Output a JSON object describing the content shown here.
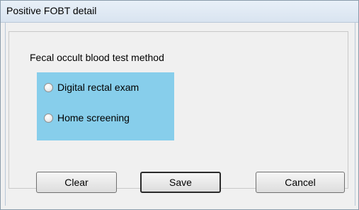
{
  "window": {
    "title": "Positive FOBT detail"
  },
  "group": {
    "label": "Fecal occult blood test method"
  },
  "radios": [
    {
      "label": "Digital rectal exam",
      "selected": false
    },
    {
      "label": "Home screening",
      "selected": false
    }
  ],
  "buttons": {
    "clear": "Clear",
    "save": "Save",
    "cancel": "Cancel"
  },
  "colors": {
    "panel": "#87ceeb",
    "window": "#f0f0f0"
  }
}
